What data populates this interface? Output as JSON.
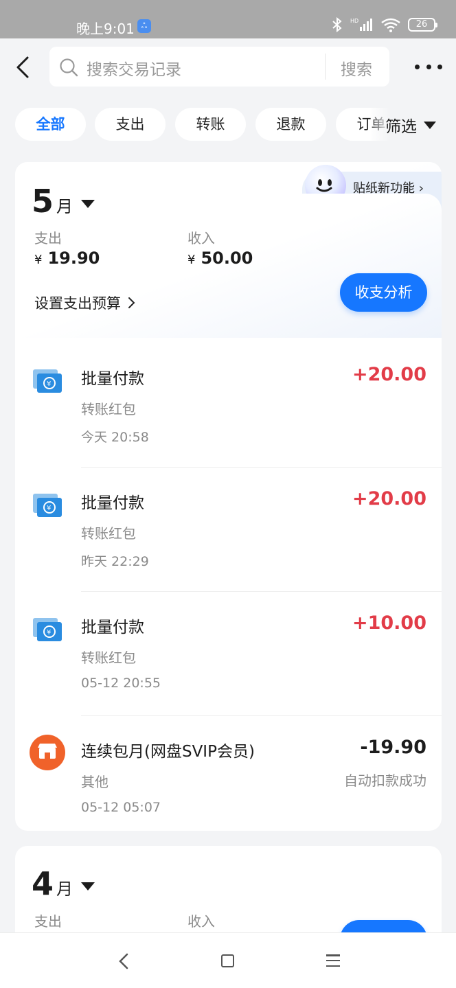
{
  "status_bar": {
    "time": "晚上9:01",
    "battery": "26",
    "app_badge": "ஃ"
  },
  "search": {
    "placeholder": "搜索交易记录",
    "button": "搜索"
  },
  "filters": {
    "chips": [
      "全部",
      "支出",
      "转账",
      "退款",
      "订单"
    ],
    "active": "全部",
    "filter_button": "筛选"
  },
  "colors": {
    "accent": "#1677ff",
    "income": "#e23c48",
    "expense": "#1c1c1c",
    "transfer_icon": "#2a8ce0",
    "shop_icon": "#f0622a"
  },
  "months": [
    {
      "month_num": "5",
      "month_unit": "月",
      "expense_label": "支出",
      "expense_currency": "¥",
      "expense_value": "19.90",
      "income_label": "收入",
      "income_currency": "¥",
      "income_value": "50.00",
      "budget_link": "设置支出预算",
      "analysis_button": "收支分析",
      "sticker_label": "贴纸新功能"
    },
    {
      "month_num": "4",
      "month_unit": "月",
      "expense_label": "支出",
      "income_label": "收入"
    }
  ],
  "transactions": [
    {
      "icon": "transfer-icon",
      "title": "批量付款",
      "category": "转账红包",
      "time": "今天 20:58",
      "amount": "+20.00",
      "type": "income",
      "status": ""
    },
    {
      "icon": "transfer-icon",
      "title": "批量付款",
      "category": "转账红包",
      "time": "昨天 22:29",
      "amount": "+20.00",
      "type": "income",
      "status": ""
    },
    {
      "icon": "transfer-icon",
      "title": "批量付款",
      "category": "转账红包",
      "time": "05-12 20:55",
      "amount": "+10.00",
      "type": "income",
      "status": ""
    },
    {
      "icon": "shop-icon",
      "title": "连续包月(网盘SVIP会员)",
      "category": "其他",
      "time": "05-12 05:07",
      "amount": "-19.90",
      "type": "expense",
      "status": "自动扣款成功"
    }
  ]
}
